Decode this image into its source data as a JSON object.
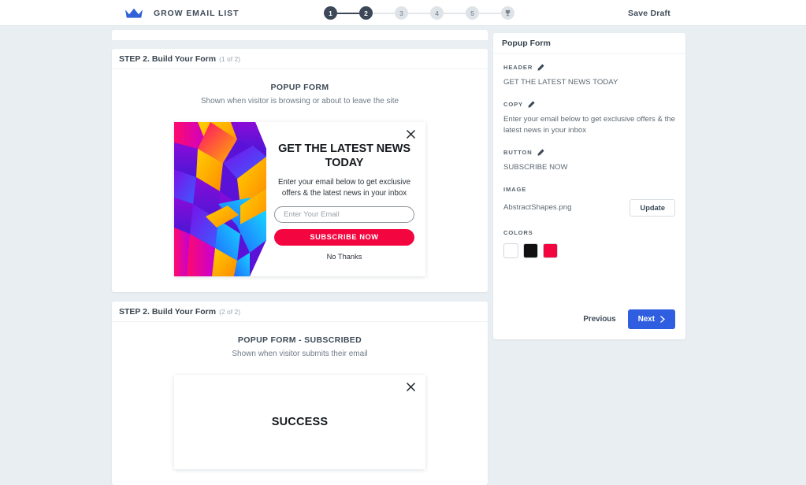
{
  "topbar": {
    "logo_icon": "crown-icon",
    "brand": "GROW EMAIL LIST",
    "save_draft": "Save Draft",
    "stepper": {
      "steps": [
        {
          "label": "1",
          "state": "active"
        },
        {
          "label": "2",
          "state": "active"
        },
        {
          "label": "3",
          "state": "inactive"
        },
        {
          "label": "4",
          "state": "inactive"
        },
        {
          "label": "5",
          "state": "inactive"
        },
        {
          "label": "trophy-icon",
          "state": "trophy"
        }
      ]
    }
  },
  "sections": [
    {
      "head_title": "STEP 2. Build Your Form",
      "head_count": "(1 of 2)",
      "preview_title": "POPUP FORM",
      "preview_sub": "Shown when visitor is browsing or about to leave the site",
      "popup": {
        "close_icon": "close-icon",
        "header": "GET THE LATEST NEWS TODAY",
        "copy": "Enter your email below to get exclusive offers & the latest news in your inbox",
        "input_placeholder": "Enter Your Email",
        "button": "SUBSCRIBE NOW",
        "decline": "No Thanks",
        "image_name": "AbstractShapes.png"
      }
    },
    {
      "head_title": "STEP 2. Build Your Form",
      "head_count": "(2 of 2)",
      "preview_title": "POPUP FORM - SUBSCRIBED",
      "preview_sub": "Shown when visitor submits their email",
      "popup": {
        "close_icon": "close-icon",
        "header": "SUCCESS"
      }
    }
  ],
  "sidebar": {
    "title": "Popup Form",
    "fields": [
      {
        "label": "HEADER",
        "icon": "pencil-icon",
        "value": "GET THE LATEST NEWS TODAY"
      },
      {
        "label": "COPY",
        "icon": "pencil-icon",
        "value": "Enter your email below to get exclusive offers & the latest news in your inbox"
      },
      {
        "label": "BUTTON",
        "icon": "pencil-icon",
        "value": "SUBSCRIBE NOW"
      }
    ],
    "image": {
      "label": "IMAGE",
      "filename": "AbstractShapes.png",
      "update_label": "Update"
    },
    "colors": {
      "label": "COLORS",
      "swatches": [
        "#ffffff",
        "#111111",
        "#f3063f"
      ]
    },
    "footer": {
      "previous": "Previous",
      "next": "Next",
      "next_icon": "chevron-right-icon"
    }
  },
  "theme": {
    "page_bg": "#e9eef2",
    "accent_blue": "#2f5fe0",
    "accent_red": "#f3063f",
    "step_active": "#3c4858",
    "step_inactive": "#dee3e8"
  }
}
